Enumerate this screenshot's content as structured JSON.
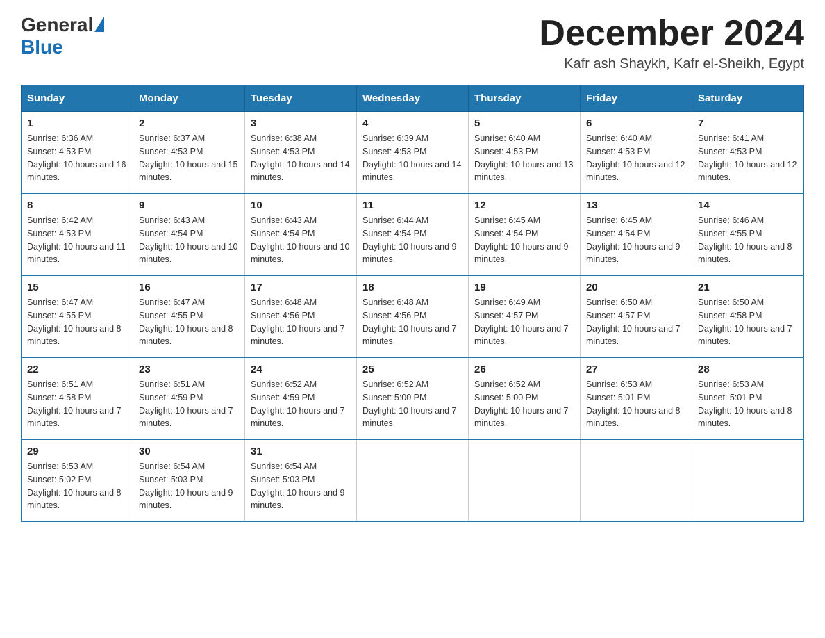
{
  "header": {
    "logo_general": "General",
    "logo_blue": "Blue",
    "month_title": "December 2024",
    "location": "Kafr ash Shaykh, Kafr el-Sheikh, Egypt"
  },
  "days_of_week": [
    "Sunday",
    "Monday",
    "Tuesday",
    "Wednesday",
    "Thursday",
    "Friday",
    "Saturday"
  ],
  "weeks": [
    [
      {
        "day": "1",
        "sunrise": "Sunrise: 6:36 AM",
        "sunset": "Sunset: 4:53 PM",
        "daylight": "Daylight: 10 hours and 16 minutes."
      },
      {
        "day": "2",
        "sunrise": "Sunrise: 6:37 AM",
        "sunset": "Sunset: 4:53 PM",
        "daylight": "Daylight: 10 hours and 15 minutes."
      },
      {
        "day": "3",
        "sunrise": "Sunrise: 6:38 AM",
        "sunset": "Sunset: 4:53 PM",
        "daylight": "Daylight: 10 hours and 14 minutes."
      },
      {
        "day": "4",
        "sunrise": "Sunrise: 6:39 AM",
        "sunset": "Sunset: 4:53 PM",
        "daylight": "Daylight: 10 hours and 14 minutes."
      },
      {
        "day": "5",
        "sunrise": "Sunrise: 6:40 AM",
        "sunset": "Sunset: 4:53 PM",
        "daylight": "Daylight: 10 hours and 13 minutes."
      },
      {
        "day": "6",
        "sunrise": "Sunrise: 6:40 AM",
        "sunset": "Sunset: 4:53 PM",
        "daylight": "Daylight: 10 hours and 12 minutes."
      },
      {
        "day": "7",
        "sunrise": "Sunrise: 6:41 AM",
        "sunset": "Sunset: 4:53 PM",
        "daylight": "Daylight: 10 hours and 12 minutes."
      }
    ],
    [
      {
        "day": "8",
        "sunrise": "Sunrise: 6:42 AM",
        "sunset": "Sunset: 4:53 PM",
        "daylight": "Daylight: 10 hours and 11 minutes."
      },
      {
        "day": "9",
        "sunrise": "Sunrise: 6:43 AM",
        "sunset": "Sunset: 4:54 PM",
        "daylight": "Daylight: 10 hours and 10 minutes."
      },
      {
        "day": "10",
        "sunrise": "Sunrise: 6:43 AM",
        "sunset": "Sunset: 4:54 PM",
        "daylight": "Daylight: 10 hours and 10 minutes."
      },
      {
        "day": "11",
        "sunrise": "Sunrise: 6:44 AM",
        "sunset": "Sunset: 4:54 PM",
        "daylight": "Daylight: 10 hours and 9 minutes."
      },
      {
        "day": "12",
        "sunrise": "Sunrise: 6:45 AM",
        "sunset": "Sunset: 4:54 PM",
        "daylight": "Daylight: 10 hours and 9 minutes."
      },
      {
        "day": "13",
        "sunrise": "Sunrise: 6:45 AM",
        "sunset": "Sunset: 4:54 PM",
        "daylight": "Daylight: 10 hours and 9 minutes."
      },
      {
        "day": "14",
        "sunrise": "Sunrise: 6:46 AM",
        "sunset": "Sunset: 4:55 PM",
        "daylight": "Daylight: 10 hours and 8 minutes."
      }
    ],
    [
      {
        "day": "15",
        "sunrise": "Sunrise: 6:47 AM",
        "sunset": "Sunset: 4:55 PM",
        "daylight": "Daylight: 10 hours and 8 minutes."
      },
      {
        "day": "16",
        "sunrise": "Sunrise: 6:47 AM",
        "sunset": "Sunset: 4:55 PM",
        "daylight": "Daylight: 10 hours and 8 minutes."
      },
      {
        "day": "17",
        "sunrise": "Sunrise: 6:48 AM",
        "sunset": "Sunset: 4:56 PM",
        "daylight": "Daylight: 10 hours and 7 minutes."
      },
      {
        "day": "18",
        "sunrise": "Sunrise: 6:48 AM",
        "sunset": "Sunset: 4:56 PM",
        "daylight": "Daylight: 10 hours and 7 minutes."
      },
      {
        "day": "19",
        "sunrise": "Sunrise: 6:49 AM",
        "sunset": "Sunset: 4:57 PM",
        "daylight": "Daylight: 10 hours and 7 minutes."
      },
      {
        "day": "20",
        "sunrise": "Sunrise: 6:50 AM",
        "sunset": "Sunset: 4:57 PM",
        "daylight": "Daylight: 10 hours and 7 minutes."
      },
      {
        "day": "21",
        "sunrise": "Sunrise: 6:50 AM",
        "sunset": "Sunset: 4:58 PM",
        "daylight": "Daylight: 10 hours and 7 minutes."
      }
    ],
    [
      {
        "day": "22",
        "sunrise": "Sunrise: 6:51 AM",
        "sunset": "Sunset: 4:58 PM",
        "daylight": "Daylight: 10 hours and 7 minutes."
      },
      {
        "day": "23",
        "sunrise": "Sunrise: 6:51 AM",
        "sunset": "Sunset: 4:59 PM",
        "daylight": "Daylight: 10 hours and 7 minutes."
      },
      {
        "day": "24",
        "sunrise": "Sunrise: 6:52 AM",
        "sunset": "Sunset: 4:59 PM",
        "daylight": "Daylight: 10 hours and 7 minutes."
      },
      {
        "day": "25",
        "sunrise": "Sunrise: 6:52 AM",
        "sunset": "Sunset: 5:00 PM",
        "daylight": "Daylight: 10 hours and 7 minutes."
      },
      {
        "day": "26",
        "sunrise": "Sunrise: 6:52 AM",
        "sunset": "Sunset: 5:00 PM",
        "daylight": "Daylight: 10 hours and 7 minutes."
      },
      {
        "day": "27",
        "sunrise": "Sunrise: 6:53 AM",
        "sunset": "Sunset: 5:01 PM",
        "daylight": "Daylight: 10 hours and 8 minutes."
      },
      {
        "day": "28",
        "sunrise": "Sunrise: 6:53 AM",
        "sunset": "Sunset: 5:01 PM",
        "daylight": "Daylight: 10 hours and 8 minutes."
      }
    ],
    [
      {
        "day": "29",
        "sunrise": "Sunrise: 6:53 AM",
        "sunset": "Sunset: 5:02 PM",
        "daylight": "Daylight: 10 hours and 8 minutes."
      },
      {
        "day": "30",
        "sunrise": "Sunrise: 6:54 AM",
        "sunset": "Sunset: 5:03 PM",
        "daylight": "Daylight: 10 hours and 9 minutes."
      },
      {
        "day": "31",
        "sunrise": "Sunrise: 6:54 AM",
        "sunset": "Sunset: 5:03 PM",
        "daylight": "Daylight: 10 hours and 9 minutes."
      },
      {
        "day": "",
        "sunrise": "",
        "sunset": "",
        "daylight": ""
      },
      {
        "day": "",
        "sunrise": "",
        "sunset": "",
        "daylight": ""
      },
      {
        "day": "",
        "sunrise": "",
        "sunset": "",
        "daylight": ""
      },
      {
        "day": "",
        "sunrise": "",
        "sunset": "",
        "daylight": ""
      }
    ]
  ]
}
